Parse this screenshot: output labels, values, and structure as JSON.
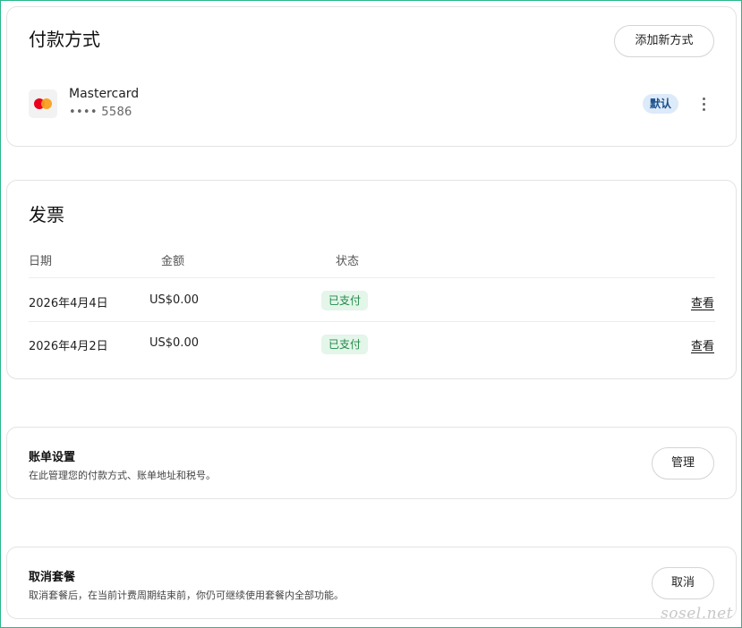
{
  "payment": {
    "title": "付款方式",
    "add_button": "添加新方式",
    "card": {
      "brand": "Mastercard",
      "number": "•••• 5586",
      "badge": "默认",
      "logo_icon": "mastercard-icon"
    }
  },
  "invoices": {
    "title": "发票",
    "headers": {
      "date": "日期",
      "amount": "金额",
      "status": "状态"
    },
    "rows": [
      {
        "date": "2026年4月4日",
        "amount": "US$0.00",
        "status": "已支付",
        "action": "查看"
      },
      {
        "date": "2026年4月2日",
        "amount": "US$0.00",
        "status": "已支付",
        "action": "查看"
      }
    ]
  },
  "billing": {
    "title": "账单设置",
    "description": "在此管理您的付款方式、账单地址和税号。",
    "button": "管理"
  },
  "cancel": {
    "title": "取消套餐",
    "description": "取消套餐后，在当前计费周期结束前，你仍可继续使用套餐内全部功能。",
    "button": "取消"
  },
  "watermark": "sosel.net",
  "colors": {
    "frame_border": "#2bb58a",
    "default_badge_bg": "#dceaf9",
    "paid_badge_bg": "#e4f5ea",
    "paid_badge_text": "#1f8a46"
  }
}
